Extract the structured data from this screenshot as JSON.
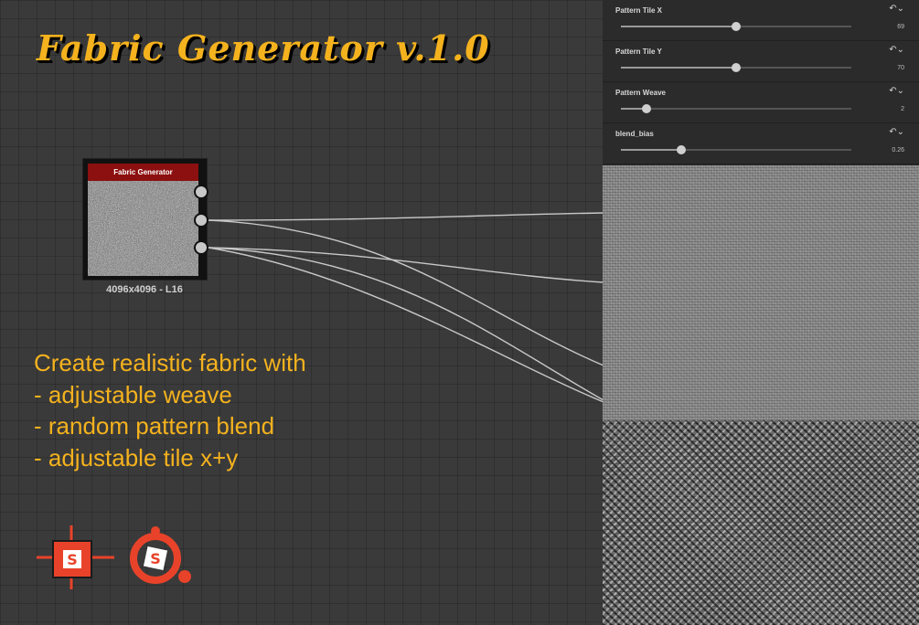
{
  "title": "Fabric Generator v.1.0",
  "node": {
    "header": "Fabric Generator",
    "label": "4096x4096 - L16"
  },
  "description": [
    "Create realistic fabric with",
    "- adjustable weave",
    "- random pattern blend",
    "- adjustable tile x+y"
  ],
  "parameters": [
    {
      "label": "Pattern Tile X",
      "value": "69",
      "fraction": 0.5
    },
    {
      "label": "Pattern Tile Y",
      "value": "70",
      "fraction": 0.5
    },
    {
      "label": "Pattern Weave",
      "value": "2",
      "fraction": 0.11
    },
    {
      "label": "blend_bias",
      "value": "0.26",
      "fraction": 0.26
    }
  ],
  "colors": {
    "accent": "#f4b21e",
    "node_header": "#8c1010",
    "logo_red": "#e8432a",
    "background": "#3a3a3a"
  },
  "icons": {
    "reset": "reset-icon",
    "logo_left": "substance-designer-logo-icon",
    "logo_right": "substance-painter-logo-icon"
  }
}
